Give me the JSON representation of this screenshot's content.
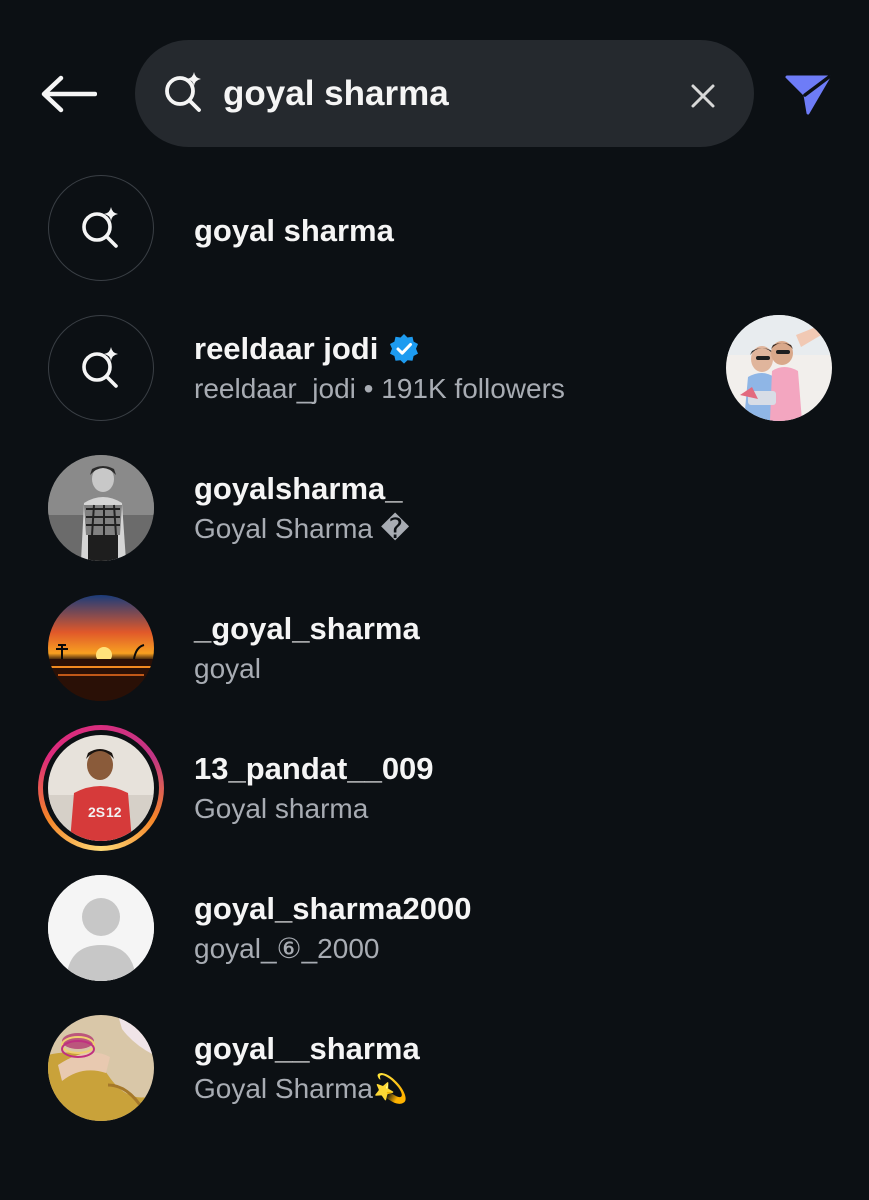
{
  "search": {
    "query": "goyal sharma"
  },
  "colors": {
    "background": "#0c1014",
    "search_bg": "#25292e",
    "accent_direct": "#6e7cf7",
    "verified": "#1d9bf0",
    "secondary_text": "#a8acb3"
  },
  "results": [
    {
      "type": "keyword",
      "icon": "sparkle-search-icon",
      "title": "goyal sharma"
    },
    {
      "type": "keyword",
      "icon": "sparkle-search-icon",
      "title": "reeldaar jodi",
      "verified": true,
      "subtitle": "reeldaar_jodi • 191K followers"
    },
    {
      "type": "account",
      "title": "goyalsharma_",
      "subtitle": "Goyal Sharma �"
    },
    {
      "type": "account",
      "title": "_goyal_sharma",
      "subtitle": "goyal"
    },
    {
      "type": "account",
      "story": true,
      "title": "13_pandat__009",
      "subtitle": "Goyal sharma"
    },
    {
      "type": "account",
      "title": "goyal_sharma2000",
      "subtitle": "goyal_⑥_2000"
    },
    {
      "type": "account",
      "title": "goyal__sharma",
      "subtitle": "Goyal Sharma💫"
    }
  ]
}
